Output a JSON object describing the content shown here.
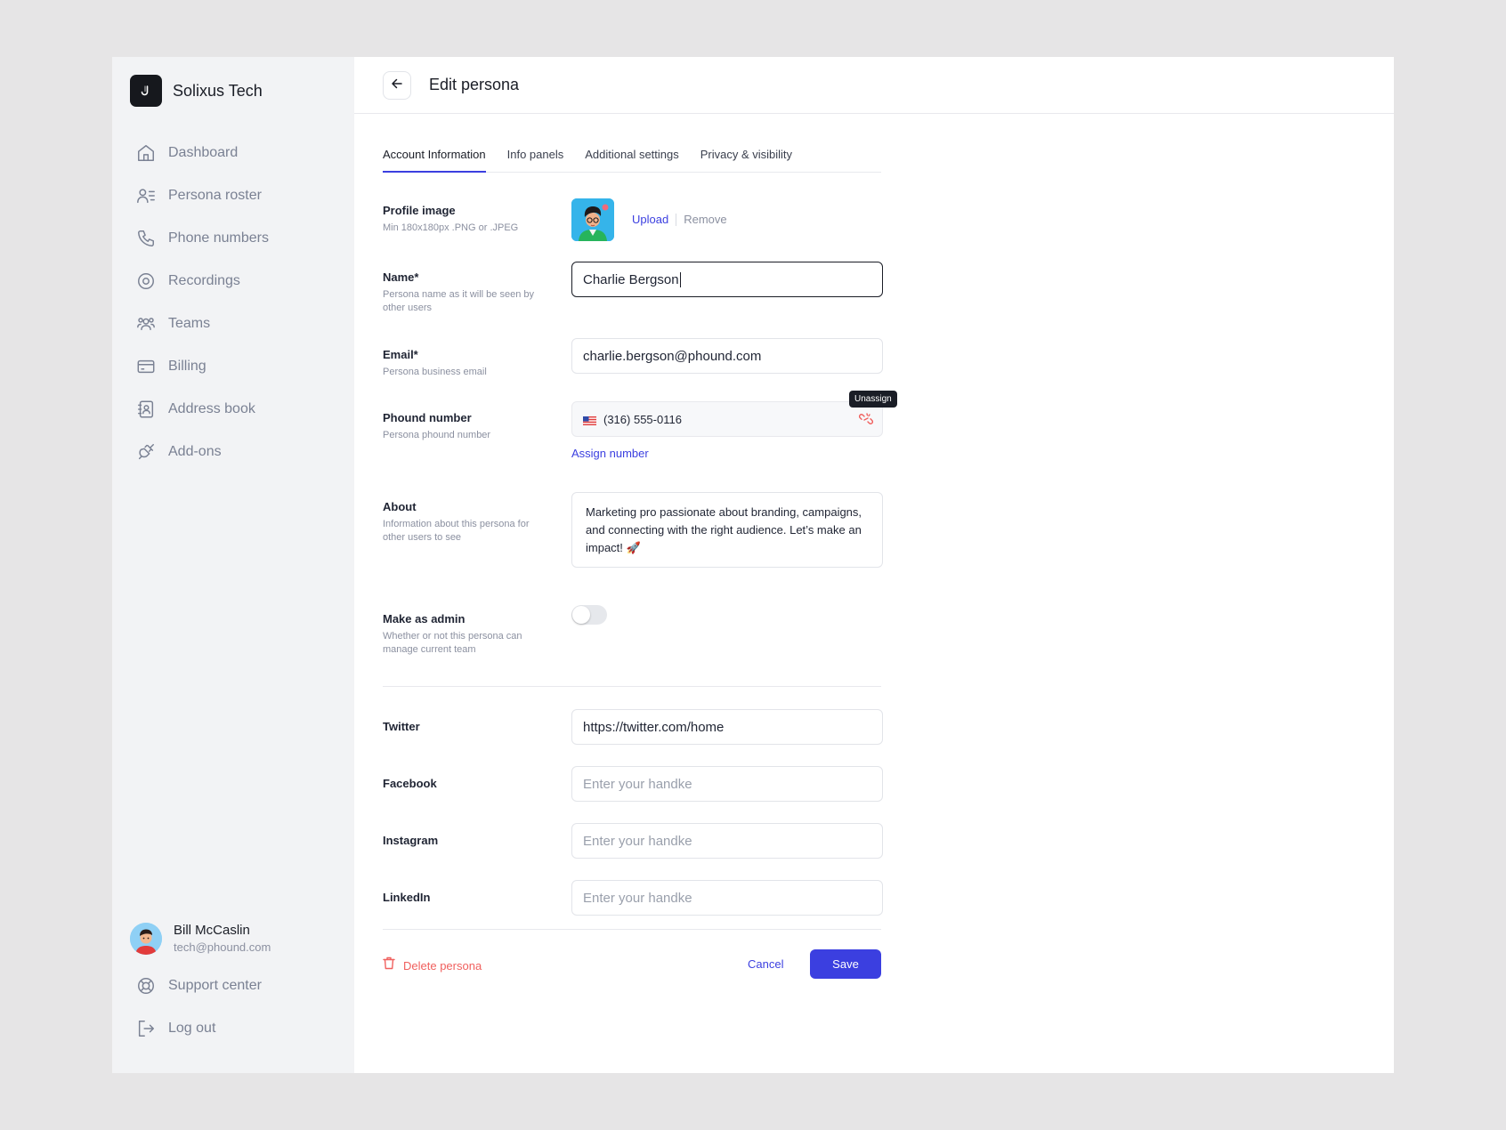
{
  "brand": {
    "name": "Solixus Tech",
    "icon": "brand-logo"
  },
  "sidebar": {
    "items": [
      {
        "label": "Dashboard",
        "icon": "home-icon"
      },
      {
        "label": "Persona roster",
        "icon": "user-list-icon"
      },
      {
        "label": "Phone numbers",
        "icon": "phone-icon"
      },
      {
        "label": "Recordings",
        "icon": "record-icon"
      },
      {
        "label": "Teams",
        "icon": "team-icon"
      },
      {
        "label": "Billing",
        "icon": "credit-card-icon"
      },
      {
        "label": "Address book",
        "icon": "address-book-icon"
      },
      {
        "label": "Add-ons",
        "icon": "plug-icon"
      }
    ],
    "user": {
      "name": "Bill McCaslin",
      "email": "tech@phound.com"
    },
    "bottom": [
      {
        "label": "Support center",
        "icon": "lifebuoy-icon"
      },
      {
        "label": "Log out",
        "icon": "logout-icon"
      }
    ]
  },
  "header": {
    "title": "Edit persona"
  },
  "tabs": [
    {
      "label": "Account Information",
      "active": true
    },
    {
      "label": "Info panels",
      "active": false
    },
    {
      "label": "Additional settings",
      "active": false
    },
    {
      "label": "Privacy & visibility",
      "active": false
    }
  ],
  "form": {
    "profile_image": {
      "label": "Profile image",
      "hint": "Min 180x180px .PNG or .JPEG",
      "upload": "Upload",
      "remove": "Remove"
    },
    "name": {
      "label": "Name*",
      "hint": "Persona name as it will be seen by other users",
      "value": "Charlie Bergson"
    },
    "email": {
      "label": "Email*",
      "hint": "Persona business email",
      "value": "charlie.bergson@phound.com"
    },
    "phound_number": {
      "label": "Phound number",
      "hint": "Persona phound number",
      "value": "(316) 555-0116",
      "tooltip": "Unassign",
      "assign": "Assign number"
    },
    "about": {
      "label": "About",
      "hint": "Information about this persona for other users to see",
      "value": "Marketing pro passionate about branding, campaigns, and connecting with the right audience. Let’s make an impact! 🚀"
    },
    "admin": {
      "label": "Make as admin",
      "hint": "Whether or not this persona can manage current team",
      "enabled": false
    },
    "twitter": {
      "label": "Twitter",
      "value": "https://twitter.com/home"
    },
    "facebook": {
      "label": "Facebook",
      "placeholder": "Enter your handke"
    },
    "instagram": {
      "label": "Instagram",
      "placeholder": "Enter your handke"
    },
    "linkedin": {
      "label": "LinkedIn",
      "placeholder": "Enter your handke"
    }
  },
  "actions": {
    "delete": "Delete persona",
    "cancel": "Cancel",
    "save": "Save"
  },
  "colors": {
    "accent": "#3b3fe0",
    "danger": "#f0605e",
    "sidebar_bg": "#f2f3f5"
  }
}
